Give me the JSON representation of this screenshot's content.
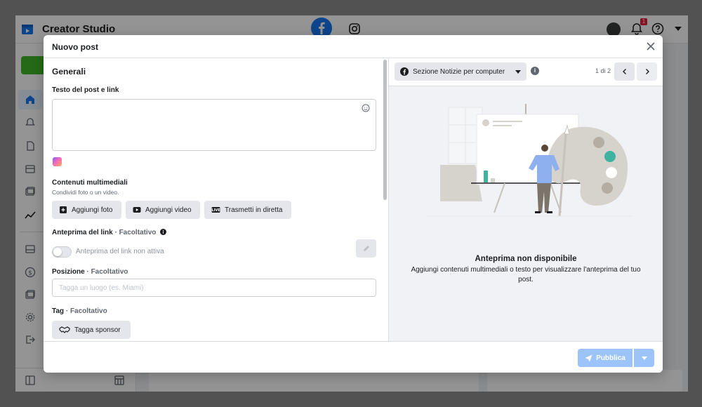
{
  "app": {
    "title": "Creator Studio",
    "notification_count": "1"
  },
  "modal": {
    "title": "Nuovo post",
    "general_section": "Generali",
    "post_text_label": "Testo del post e link",
    "media_label": "Contenuti multimediali",
    "media_sub": "Condividi foto o un video.",
    "add_photo": "Aggiungi foto",
    "add_video": "Aggiungi video",
    "live": "Trasmetti in diretta",
    "link_preview_label": "Anteprima del link",
    "optional": "Facoltativo",
    "link_preview_off": "Anteprima del link non attiva",
    "position_label": "Posizione",
    "position_placeholder": "Tagga un luogo (es. Miami)",
    "tag_label": "Tag",
    "tag_sponsor": "Tagga sponsor",
    "separator": " · "
  },
  "preview": {
    "feed_select": "Sezione Notizie per computer",
    "pager": "1 di 2",
    "title": "Anteprima non disponibile",
    "subtitle": "Aggiungi contenuti multimediali o testo per visualizzare l'anteprima del tuo post."
  },
  "footer": {
    "publish": "Pubblica"
  },
  "colors": {
    "primary": "#1877f2",
    "publish_disabled": "#9cc4fb",
    "brand_green": "#42b72a",
    "illustration_teal": "#3fb39f"
  }
}
